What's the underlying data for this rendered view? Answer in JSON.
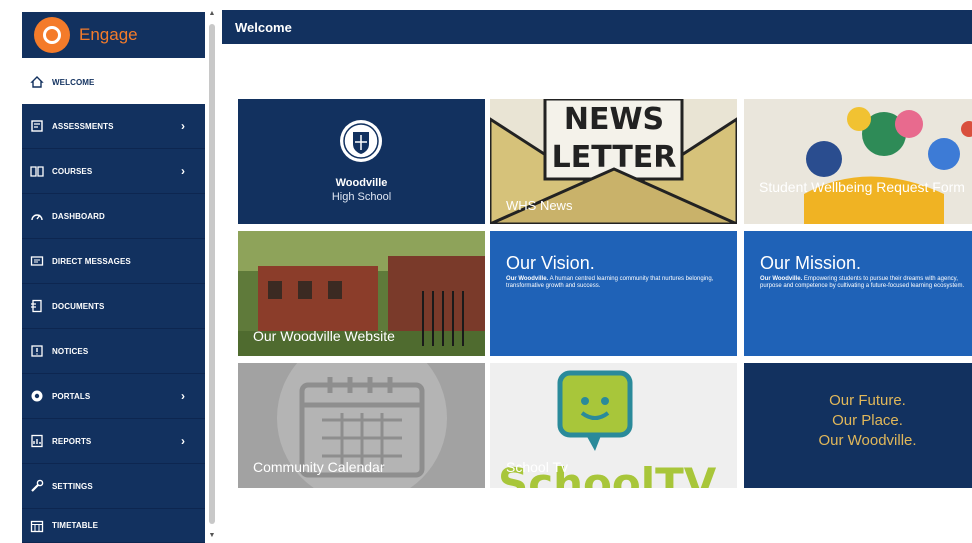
{
  "app": {
    "brand": "Engage"
  },
  "colors": {
    "navy": "#12315f",
    "accent_orange": "#f47b2a",
    "tile_blue": "#1f62b7",
    "gold": "#e0b75a"
  },
  "sidebar": {
    "items": [
      {
        "label": "WELCOME",
        "icon": "home-icon",
        "active": true
      },
      {
        "label": "ASSESSMENTS",
        "icon": "assessments-icon",
        "has_submenu": true
      },
      {
        "label": "COURSES",
        "icon": "book-icon",
        "has_submenu": true
      },
      {
        "label": "DASHBOARD",
        "icon": "gauge-icon"
      },
      {
        "label": "DIRECT MESSAGES",
        "icon": "message-icon"
      },
      {
        "label": "DOCUMENTS",
        "icon": "documents-icon"
      },
      {
        "label": "NOTICES",
        "icon": "notice-icon"
      },
      {
        "label": "PORTALS",
        "icon": "portal-icon",
        "has_submenu": true
      },
      {
        "label": "REPORTS",
        "icon": "reports-icon",
        "has_submenu": true
      },
      {
        "label": "SETTINGS",
        "icon": "wrench-icon"
      },
      {
        "label": "TIMETABLE",
        "icon": "timetable-icon"
      }
    ]
  },
  "header": {
    "title": "Welcome"
  },
  "tiles": {
    "school": {
      "name": "Woodville",
      "sub": "High School"
    },
    "news": {
      "caption": "WHS News",
      "art_line1": "NEWS",
      "art_line2": "LETTER"
    },
    "wellbeing": {
      "caption": "Student Wellbeing Request Form"
    },
    "website": {
      "caption": "Our Woodville Website"
    },
    "vision": {
      "heading": "Our Vision.",
      "lead": "Our Woodville.",
      "body": "A human centred learning community that nurtures belonging, transformative growth and success."
    },
    "mission": {
      "heading": "Our Mission.",
      "lead": "Our Woodville.",
      "body": "Empowering students to pursue their dreams with agency, purpose and competence by cultivating a future-focused learning ecosystem."
    },
    "calendar": {
      "caption": "Community Calendar"
    },
    "tv": {
      "caption": "School Tv",
      "art_text": "SchoolTV"
    },
    "future": {
      "line1": "Our Future.",
      "line2": "Our Place.",
      "line3": "Our Woodville."
    }
  }
}
